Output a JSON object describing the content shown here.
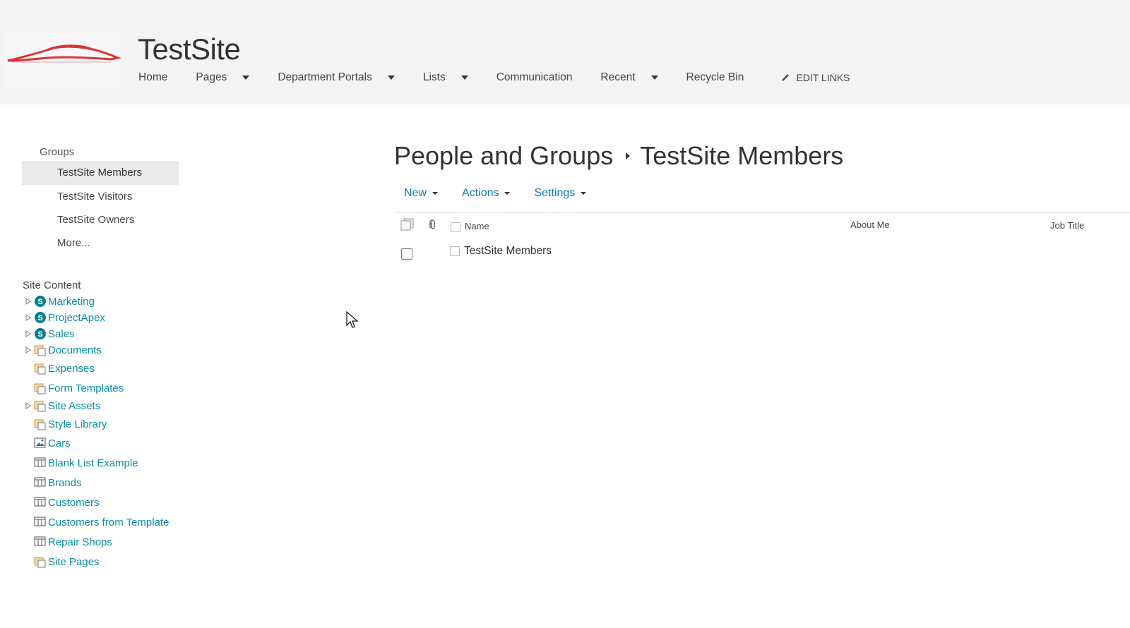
{
  "header": {
    "site_title": "TestSite",
    "nav": [
      {
        "label": "Home",
        "dropdown": false
      },
      {
        "label": "Pages",
        "dropdown": true
      },
      {
        "label": "Department Portals",
        "dropdown": true
      },
      {
        "label": "Lists",
        "dropdown": true
      },
      {
        "label": "Communication",
        "dropdown": false
      },
      {
        "label": "Recent",
        "dropdown": true
      },
      {
        "label": "Recycle Bin",
        "dropdown": false
      }
    ],
    "edit_links": "EDIT LINKS"
  },
  "left_nav": {
    "groups_heading": "Groups",
    "groups": [
      "TestSite Members",
      "TestSite Visitors",
      "TestSite Owners",
      "More..."
    ],
    "selected_group": "TestSite Members",
    "site_content_heading": "Site Content",
    "site_content": [
      {
        "label": "Marketing",
        "icon": "subsite-icon",
        "expandable": true
      },
      {
        "label": "ProjectApex",
        "icon": "subsite-icon",
        "expandable": true
      },
      {
        "label": "Sales",
        "icon": "subsite-icon",
        "expandable": true
      },
      {
        "label": "Documents",
        "icon": "library-icon",
        "expandable": true
      },
      {
        "label": "Expenses",
        "icon": "library-icon",
        "expandable": false
      },
      {
        "label": "Form Templates",
        "icon": "library-icon",
        "expandable": false
      },
      {
        "label": "Site Assets",
        "icon": "library-icon",
        "expandable": true
      },
      {
        "label": "Style Library",
        "icon": "library-icon",
        "expandable": false
      },
      {
        "label": "Cars",
        "icon": "picture-library-icon",
        "expandable": false
      },
      {
        "label": "Blank List Example",
        "icon": "list-icon",
        "expandable": false
      },
      {
        "label": "Brands",
        "icon": "list-icon",
        "expandable": false
      },
      {
        "label": "Customers",
        "icon": "list-icon",
        "expandable": false
      },
      {
        "label": "Customers from Template",
        "icon": "list-icon",
        "expandable": false
      },
      {
        "label": "Repair Shops",
        "icon": "list-icon",
        "expandable": false
      },
      {
        "label": "Site Pages",
        "icon": "library-icon",
        "expandable": false
      }
    ]
  },
  "main": {
    "breadcrumb_root": "People and Groups",
    "breadcrumb_current": "TestSite Members",
    "toolbar": {
      "new": "New",
      "actions": "Actions",
      "settings": "Settings"
    },
    "columns": {
      "name": "Name",
      "about_me": "About Me",
      "job_title": "Job Title"
    },
    "rows": [
      {
        "name": "TestSite Members"
      }
    ]
  },
  "colors": {
    "link": "#0a8ea0",
    "toolbar_link": "#0a7ab8",
    "header_bg": "#f4f4f4",
    "selected_bg": "#eaeaea"
  }
}
